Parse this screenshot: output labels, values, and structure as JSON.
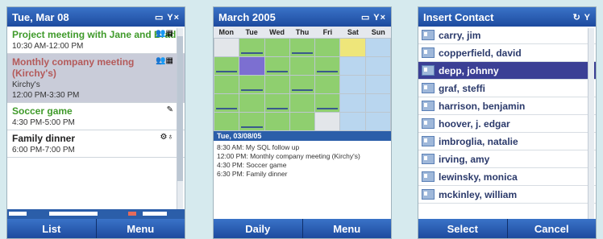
{
  "agenda": {
    "title": "Tue, Mar 08",
    "title_icons": "▭ Y×",
    "appointments": [
      {
        "title": "Project meeting with Jane and Brad",
        "time": "10:30 AM-12:00 PM",
        "location": ""
      },
      {
        "title": "Monthly company meeting (Kirchy's)",
        "location": "Kirchy's",
        "time": "12:00 PM-3:30 PM"
      },
      {
        "title": "Soccer game",
        "time": "4:30 PM-5:00 PM",
        "location": ""
      },
      {
        "title": "Family dinner",
        "time": "6:00 PM-7:00 PM",
        "location": ""
      }
    ],
    "softkey_left": "List",
    "softkey_right": "Menu"
  },
  "month": {
    "title": "March 2005",
    "title_icons": "▭ Y×",
    "weekdays": [
      "Mon",
      "Tue",
      "Wed",
      "Thu",
      "Fri",
      "Sat",
      "Sun"
    ],
    "selected_date": "Tue, 03/08/05",
    "events": [
      "8:30 AM: My SQL follow up",
      "12:00 PM: Monthly company meeting (Kirchy's)",
      "4:30 PM: Soccer game",
      "6:30 PM: Family dinner"
    ],
    "softkey_left": "Daily",
    "softkey_right": "Menu"
  },
  "contacts": {
    "title": "Insert Contact",
    "title_icons": "↻ Y",
    "list": [
      "carry, jim",
      "copperfield, david",
      "depp, johnny",
      "graf, steffi",
      "harrison, benjamin",
      "hoover, j. edgar",
      "imbroglia, natalie",
      "irving, amy",
      "lewinsky, monica",
      "mckinley, william"
    ],
    "selected_index": 2,
    "softkey_left": "Select",
    "softkey_right": "Cancel"
  }
}
